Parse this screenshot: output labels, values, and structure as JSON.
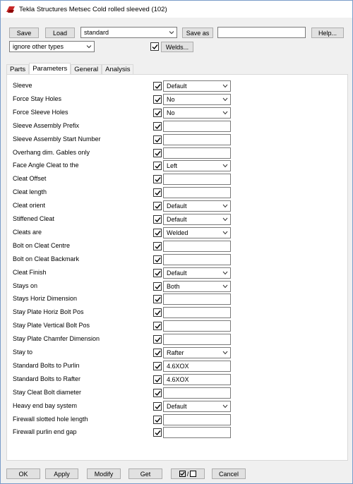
{
  "window": {
    "title": "Tekla Structures  Metsec Cold rolled sleeved (102)"
  },
  "top": {
    "save": "Save",
    "load": "Load",
    "preset": "standard",
    "save_as": "Save as",
    "save_as_value": "",
    "help": "Help...",
    "filter": "ignore other types",
    "welds_checked": true,
    "welds": "Welds..."
  },
  "tabs": [
    "Parts",
    "Parameters",
    "General",
    "Analysis"
  ],
  "active_tab": "Parameters",
  "params": [
    {
      "label": "Sleeve",
      "checked": true,
      "type": "select",
      "value": "Default"
    },
    {
      "label": "Force Stay Holes",
      "checked": true,
      "type": "select",
      "value": "No"
    },
    {
      "label": "Force Sleeve Holes",
      "checked": true,
      "type": "select",
      "value": "No"
    },
    {
      "label": "Sleeve Assembly Prefix",
      "checked": true,
      "type": "text",
      "value": ""
    },
    {
      "label": "Sleeve Assembly Start Number",
      "checked": true,
      "type": "text",
      "value": ""
    },
    {
      "label": "Overhang dim. Gables only",
      "checked": true,
      "type": "text",
      "value": ""
    },
    {
      "label": "Face Angle Cleat to the",
      "checked": true,
      "type": "select",
      "value": "Left"
    },
    {
      "label": "Cleat Offset",
      "checked": true,
      "type": "text",
      "value": ""
    },
    {
      "label": "Cleat length",
      "checked": true,
      "type": "text",
      "value": ""
    },
    {
      "label": "Cleat orient",
      "checked": true,
      "type": "select",
      "value": "Default"
    },
    {
      "label": "Stiffened Cleat",
      "checked": true,
      "type": "select",
      "value": "Default"
    },
    {
      "label": "Cleats are",
      "checked": true,
      "type": "select",
      "value": "Welded"
    },
    {
      "label": "Bolt on Cleat Centre",
      "checked": true,
      "type": "text",
      "value": ""
    },
    {
      "label": "Bolt on Cleat Backmark",
      "checked": true,
      "type": "text",
      "value": ""
    },
    {
      "label": "Cleat Finish",
      "checked": true,
      "type": "select",
      "value": "Default"
    },
    {
      "label": "Stays on",
      "checked": true,
      "type": "select",
      "value": "Both"
    },
    {
      "label": "Stays Horiz Dimension",
      "checked": true,
      "type": "text",
      "value": ""
    },
    {
      "label": "Stay Plate Horiz Bolt Pos",
      "checked": true,
      "type": "text",
      "value": ""
    },
    {
      "label": "Stay Plate Vertical Bolt Pos",
      "checked": true,
      "type": "text",
      "value": ""
    },
    {
      "label": "Stay Plate Chamfer Dimension",
      "checked": true,
      "type": "text",
      "value": ""
    },
    {
      "label": "Stay to",
      "checked": true,
      "type": "select",
      "value": "Rafter"
    },
    {
      "label": "Standard Bolts to Purlin",
      "checked": true,
      "type": "text",
      "value": "4.6XOX"
    },
    {
      "label": "Standard Bolts to Rafter",
      "checked": true,
      "type": "text",
      "value": "4.6XOX"
    },
    {
      "label": "Stay Cleat Bolt diameter",
      "checked": true,
      "type": "text",
      "value": ""
    },
    {
      "label": "Heavy end bay system",
      "checked": true,
      "type": "select",
      "value": "Default"
    },
    {
      "label": "Firewall slotted hole length",
      "checked": true,
      "type": "text",
      "value": ""
    },
    {
      "label": "Firewall purlin end gap",
      "checked": true,
      "type": "text",
      "value": ""
    }
  ],
  "bottom": {
    "ok": "OK",
    "apply": "Apply",
    "modify": "Modify",
    "get": "Get",
    "toggle": "/",
    "cancel": "Cancel"
  }
}
